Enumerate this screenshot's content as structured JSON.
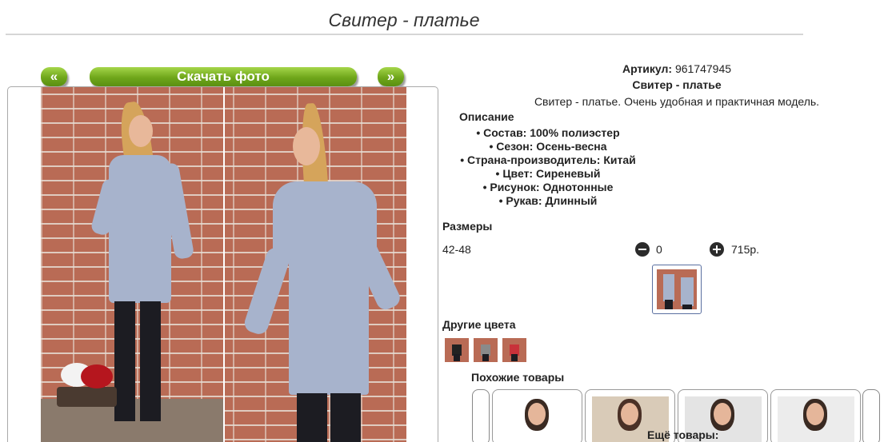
{
  "page_title": "Свитер - платье",
  "gallery": {
    "prev_label": "«",
    "download_label": "Скачать фото",
    "next_label": "»",
    "button_color": "#7bb423"
  },
  "product": {
    "article_label": "Артикул:",
    "article_value": "961747945",
    "name": "Свитер - платье",
    "description": "Свитер - платье. Очень удобная и практичная модель.",
    "description_heading": "Описание",
    "properties": [
      "Состав: 100% полиэстер",
      "Сезон: Осень-весна",
      "Страна-производитель: Китай",
      "Цвет: Сиреневый",
      "Рисунок: Однотонные",
      "Рукав: Длинный"
    ]
  },
  "sizes": {
    "heading": "Размеры",
    "size_range": "42-48",
    "quantity": "0",
    "price": "715р."
  },
  "other_colors": {
    "heading": "Другие цвета",
    "swatches": [
      "#222222",
      "#8a8a8a",
      "#c8323a"
    ]
  },
  "similar": {
    "heading": "Похожие товары",
    "more_label": "Ещё товары:"
  }
}
